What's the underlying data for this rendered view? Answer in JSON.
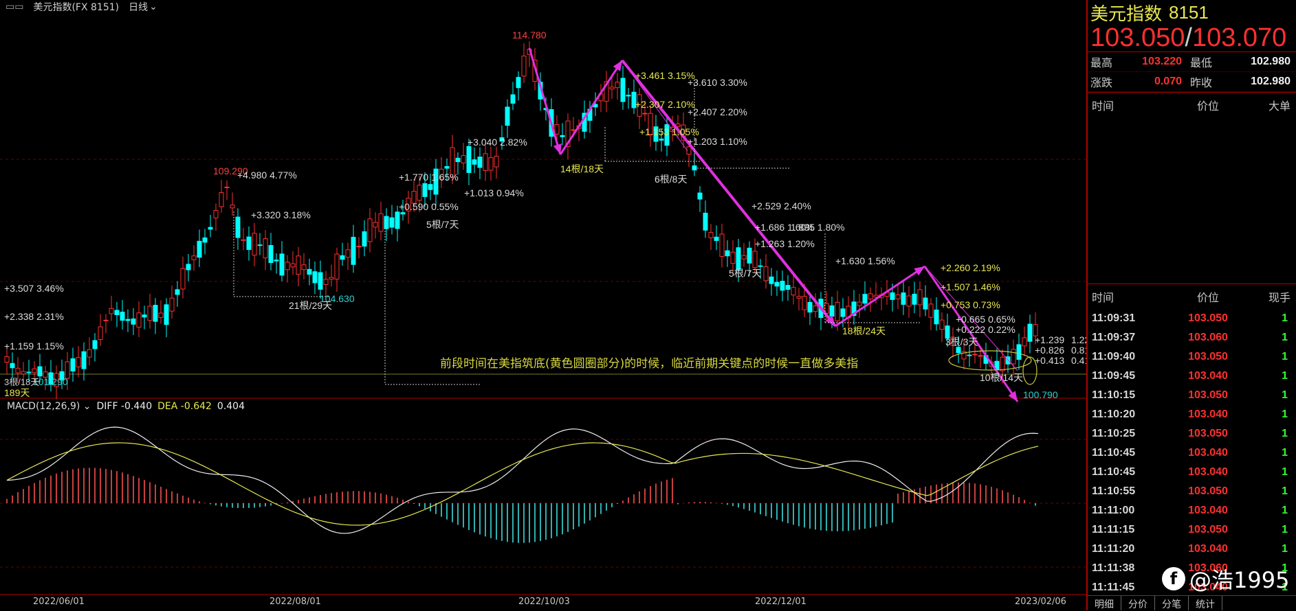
{
  "topbar": {
    "symbol": "美元指数(FX 8151)",
    "period": "日线"
  },
  "annotation": "前段时间在美指筑底(黄色圆圈部分)的时候，临近前期关键点的时候一直做多美指",
  "macd": {
    "label": "MACD(12,26,9)",
    "diff": "DIFF -0.440",
    "dea": "DEA -0.642",
    "macd": "0.404"
  },
  "price_labels": {
    "high_1": "114.780",
    "high_2": "109.290",
    "low_1": "104.630",
    "low_2": "100.790",
    "low_left": "101.290",
    "days_left": "189天",
    "left_small": "3根/18天"
  },
  "chart_texts": [
    {
      "t": "+3.507  3.46%",
      "c": "w"
    },
    {
      "t": "+2.338  2.31%",
      "c": "w"
    },
    {
      "t": "+1.159  1.15%",
      "c": "w"
    },
    {
      "t": "+4.980  4.77%",
      "c": "w"
    },
    {
      "t": "+3.320  3.18%",
      "c": "w"
    },
    {
      "t": "21根/29天",
      "c": "w"
    },
    {
      "t": "+3.040  2.82%",
      "c": "w"
    },
    {
      "t": "+1.770  1.65%",
      "c": "w"
    },
    {
      "t": "+0.590  0.55%",
      "c": "w"
    },
    {
      "t": "+1.013  0.94%",
      "c": "w"
    },
    {
      "t": "5根/7天",
      "c": "w"
    },
    {
      "t": "14根/18天",
      "c": "y"
    },
    {
      "t": "+3.461  3.15%",
      "c": "y"
    },
    {
      "t": "+3.610  3.30%",
      "c": "w"
    },
    {
      "t": "+2.307  2.10%",
      "c": "y"
    },
    {
      "t": "+2.407  2.20%",
      "c": "w"
    },
    {
      "t": "+1.153  1.05%",
      "c": "y"
    },
    {
      "t": "+1.203  1.10%",
      "c": "w"
    },
    {
      "t": "6根/8天",
      "c": "w"
    },
    {
      "t": "+2.529  2.40%",
      "c": "w"
    },
    {
      "t": "+1.686  1.60%",
      "c": "w"
    },
    {
      "t": "1.895  1.80%",
      "c": "w"
    },
    {
      "t": "+1.263  1.20%",
      "c": "w"
    },
    {
      "t": "5根/7天",
      "c": "w"
    },
    {
      "t": "+1.630  1.56%",
      "c": "w"
    },
    {
      "t": "18根/24天",
      "c": "y"
    },
    {
      "t": "+2.260  2.19%",
      "c": "y"
    },
    {
      "t": "+1.507  1.46%",
      "c": "y"
    },
    {
      "t": "+0.753  0.73%",
      "c": "y"
    },
    {
      "t": "+0.665  0.65%",
      "c": "w"
    },
    {
      "t": "+0.222  0.22%",
      "c": "w"
    },
    {
      "t": "3根/3天",
      "c": "w"
    },
    {
      "t": "10根/14天",
      "c": "w"
    },
    {
      "t": "+1.239",
      "c": "w"
    },
    {
      "t": "+0.826",
      "c": "w"
    },
    {
      "t": "+0.413",
      "c": "w"
    },
    {
      "t": "1.22",
      "c": "w"
    },
    {
      "t": "0.81",
      "c": "w"
    },
    {
      "t": "0.41",
      "c": "w"
    }
  ],
  "x_axis": [
    "2022/06/01",
    "2022/08/01",
    "2022/10/03",
    "2022/12/01",
    "2023/02/06"
  ],
  "panel": {
    "name": "美元指数",
    "code": "8151",
    "bid": "103.050",
    "ask": "103.070",
    "stats": [
      {
        "k1": "最高",
        "v1": "103.220",
        "c1": "red",
        "k2": "最低",
        "v2": "102.980",
        "c2": "white"
      },
      {
        "k1": "涨跌",
        "v1": "0.070",
        "c1": "red",
        "k2": "昨收",
        "v2": "102.980",
        "c2": "white"
      }
    ],
    "big_header": {
      "time": "时间",
      "price": "价位",
      "vol": "大单"
    },
    "tick_header": {
      "time": "时间",
      "price": "价位",
      "vol": "现手"
    },
    "ticks": [
      {
        "time": "11:09:31",
        "price": "103.050",
        "vol": "1"
      },
      {
        "time": "11:09:37",
        "price": "103.060",
        "vol": "1"
      },
      {
        "time": "11:09:40",
        "price": "103.050",
        "vol": "1"
      },
      {
        "time": "11:09:45",
        "price": "103.040",
        "vol": "1"
      },
      {
        "time": "11:10:15",
        "price": "103.050",
        "vol": "1"
      },
      {
        "time": "11:10:20",
        "price": "103.040",
        "vol": "1"
      },
      {
        "time": "11:10:25",
        "price": "103.050",
        "vol": "1"
      },
      {
        "time": "11:10:45",
        "price": "103.040",
        "vol": "1"
      },
      {
        "time": "11:10:45",
        "price": "103.040",
        "vol": "1"
      },
      {
        "time": "11:10:55",
        "price": "103.050",
        "vol": "1"
      },
      {
        "time": "11:11:00",
        "price": "103.040",
        "vol": "1"
      },
      {
        "time": "11:11:15",
        "price": "103.050",
        "vol": "1"
      },
      {
        "time": "11:11:20",
        "price": "103.040",
        "vol": "1"
      },
      {
        "time": "11:11:38",
        "price": "103.060",
        "vol": "1"
      },
      {
        "time": "11:11:45",
        "price": "103.040",
        "vol": "1"
      }
    ],
    "tabs": [
      "明细",
      "分价",
      "分笔",
      "统计"
    ]
  },
  "watermark": "@浩1995",
  "colors": {
    "up": "#ff3030",
    "down": "#00ffff",
    "arrow": "#e030e0",
    "yellow": "#e8e850"
  }
}
